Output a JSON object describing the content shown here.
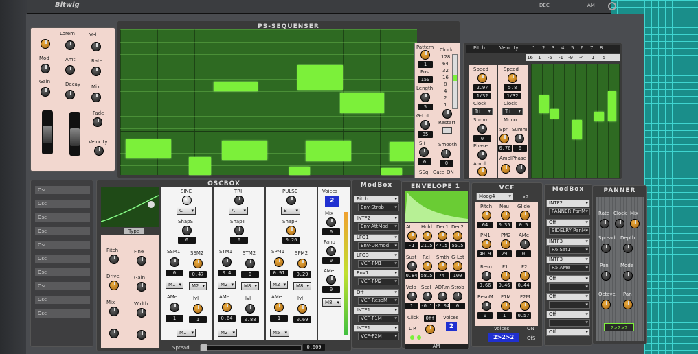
{
  "app": {
    "brand": "Bitwig",
    "top_right": [
      "DEC",
      "AM"
    ]
  },
  "modulator_panel": {
    "labels": [
      "Lorem",
      "Vel",
      "Mod",
      "Amt",
      "Rate",
      "Gain",
      "Decay",
      "Mix",
      "Fade",
      "Velocity"
    ]
  },
  "sequencer": {
    "title": "PS-SEQUENSER",
    "pattern_label": "Pattern",
    "pattern_value": "1",
    "pos_label": "Pos",
    "pos_value": "150",
    "length_label": "Length",
    "length_value": "5",
    "glot_label": "G-Lot",
    "glot_value": "85",
    "sli_label": "Sli",
    "sli_value": "0",
    "smooth_label": "Smooth",
    "smooth_value": "0",
    "clock_label": "Clock",
    "clock_values": [
      "128",
      "64",
      "32",
      "16",
      "8",
      "4",
      "2",
      "1"
    ],
    "restart_label": "Restart",
    "gate_label": "Gate",
    "ssq_label": "SSq",
    "on_label": "ON",
    "tab_pitch": "Pitch",
    "tab_velocity": "Velocity",
    "mini_steps": [
      "1",
      "2",
      "3",
      "4",
      "5",
      "6",
      "7",
      "8"
    ],
    "mini_values": [
      "16",
      "1",
      "-5",
      "-1",
      "-9",
      "-4",
      "1",
      "5"
    ]
  },
  "lfo_a": {
    "speed_label": "Speed",
    "speed_value": "2.97",
    "rate": "1/32",
    "clock_label": "Clock",
    "clock_value": "Tri",
    "summ_label": "Summ",
    "summ_value": "0",
    "phase_label": "Phase",
    "phase_value": "0",
    "ampl_label": "Ampl",
    "ampl_value": "0"
  },
  "lfo_b": {
    "speed_label": "Speed",
    "speed_value": "5.8",
    "rate": "1/32",
    "clock_label": "Clock",
    "clock_value": "Tri",
    "mono_label": "Mono",
    "spr_label": "Spr",
    "spr_value": "0.76",
    "summ_label": "Summ",
    "summ_value": "0",
    "ampl_label": "Ampl",
    "ampl_value": "0",
    "phase_label": "Phase",
    "phase_value": "0"
  },
  "osc_list": {
    "items": [
      "Osc",
      "Osc",
      "Osc",
      "Osc",
      "Osc",
      "Osc",
      "Osc",
      "Osc",
      "Osc",
      "Osc"
    ]
  },
  "oscbox": {
    "title": "OSCBOX",
    "type_label": "Type",
    "knob_labels": [
      "Pitch",
      "Fine",
      "Drive",
      "Gain",
      "Mix",
      "Width"
    ],
    "sine": {
      "label": "SINE",
      "wave": "C",
      "shap_label": "ShapS",
      "shap_value": "0",
      "ssm1": "SSM1",
      "ssm2": "SSM2",
      "ssm1_val": "0",
      "ssm2_val": "0.47",
      "m1": "M1",
      "m2": "M2",
      "ame": "AMe",
      "lvl": "lvl",
      "ame_val": "1",
      "lvl_val": "1"
    },
    "tri": {
      "label": "TRI",
      "wave": "A",
      "shap_label": "ShapT",
      "shap_value": "0",
      "stm1": "STM1",
      "stm2": "STM2",
      "stm1_val": "0.4",
      "stm2_val": "0",
      "m1": "M2",
      "m2": "M8",
      "ame": "AMe",
      "lvl": "lvl",
      "ame_val": "0.64",
      "lvl_val": "0.88",
      "bottom": "M2"
    },
    "pulse": {
      "label": "PULSE",
      "wave": "B",
      "shap_label": "ShapP",
      "shap_value": "0.26",
      "spm1": "SPM1",
      "spm2": "SPM2",
      "spm1_val": "0.91",
      "spm2_val": "0.29",
      "m1": "M2",
      "m2": "M8",
      "ame": "AMe",
      "lvl": "lvl",
      "ame_val": "1",
      "lvl_val": "0.69",
      "bottom": "M5"
    },
    "voices": {
      "label": "Voices",
      "value": "2",
      "mix_label": "Mix",
      "mix_value": "0",
      "pano_label": "Pano",
      "pano_value": "0",
      "ame_label": "AMe",
      "ame_value": "0",
      "m_label": "M8"
    },
    "spread_label": "Spread",
    "spread_value": "0.009",
    "sine_bottom": "M1"
  },
  "mod_box_1": {
    "title": "ModBox",
    "rows": [
      [
        "Pitch",
        "Env-Strob"
      ],
      [
        "INTF2",
        "Env-AttMod"
      ],
      [
        "LFO1",
        "Env-DRmod"
      ],
      [
        "LFO3",
        "VCF-FM1"
      ],
      [
        "Env1",
        "VCF-FM2"
      ],
      [
        "Off",
        "VCF-ResoM"
      ],
      [
        "INTF1",
        "VCF-F1M"
      ],
      [
        "INTF1",
        "VCF-F2M"
      ]
    ]
  },
  "envelope": {
    "title": "ENVELOPE 1",
    "att": "Att",
    "hold": "Hold",
    "dec1": "Dec1",
    "dec2": "Dec2",
    "att_v": "-1",
    "hold_v": "21.5",
    "dec1_v": "47.5",
    "dec2_v": "55.5",
    "sust": "Sust",
    "rel": "Rel",
    "smth": "Smth",
    "glot": "G-Lot",
    "sust_v": "0.84",
    "rel_v": "58.5",
    "smth_v": "74",
    "glot_v": "100",
    "velo": "Velo",
    "scal": "Scal",
    "adrm": "ADRm",
    "strob": "Strob",
    "velo_v": "1",
    "scal_v": "-0.1",
    "adrm_v": "-0.04",
    "strob_v": "0",
    "click_label": "Click",
    "click_value": "Off",
    "voices_label": "Voices",
    "voices_value": "2",
    "lr": "L R",
    "am_label": "AM"
  },
  "vcf": {
    "title": "VCF",
    "type": "Moog4",
    "x2": "x2",
    "pitch": "Pitch",
    "neu": "Neu",
    "glide": "Glide",
    "pitch_v": "64",
    "neu_v": "0.35",
    "glide_v": "0.5",
    "pm1": "PM1",
    "pm2": "PM2",
    "ame": "AMe",
    "pm1_v": "40.9",
    "pm2_v": "29",
    "ame_v": "0",
    "reso": "Reso",
    "f1": "F1",
    "f2": "F2",
    "reso_v": "0.66",
    "f1_v": "0.46",
    "f2_v": "0.44",
    "resom": "ResoM",
    "f1m": "F1M",
    "f2m": "F2M",
    "resom_v": "0",
    "f1m_v": "1",
    "f2m_v": "0.57",
    "voices_label": "Voices",
    "voices_value": "2>2>2",
    "on": "ON",
    "off": "OfS"
  },
  "mod_box_2": {
    "title": "ModBox",
    "rows": [
      [
        "INTF2",
        "PANNER PanM"
      ],
      [
        "Off",
        "SIDELRY PanM"
      ],
      [
        "INTF3",
        "R6 Sat1"
      ],
      [
        "INTF3",
        "R5 AMe"
      ],
      [
        "Off",
        ""
      ],
      [
        "Off",
        ""
      ],
      [
        "Off",
        ""
      ],
      [
        "Off",
        ""
      ]
    ]
  },
  "panner": {
    "title": "PANNER",
    "labels": [
      "Rate",
      "Clock",
      "Mix",
      "Spread",
      "Depth",
      "Pan",
      "Mode",
      "Octave",
      "Pan"
    ],
    "value": "2>2>2"
  },
  "accent": {
    "green": "#7cf03a",
    "orange": "#f0a030",
    "blue": "#2030d0",
    "cyan": "#3fd5d0"
  }
}
